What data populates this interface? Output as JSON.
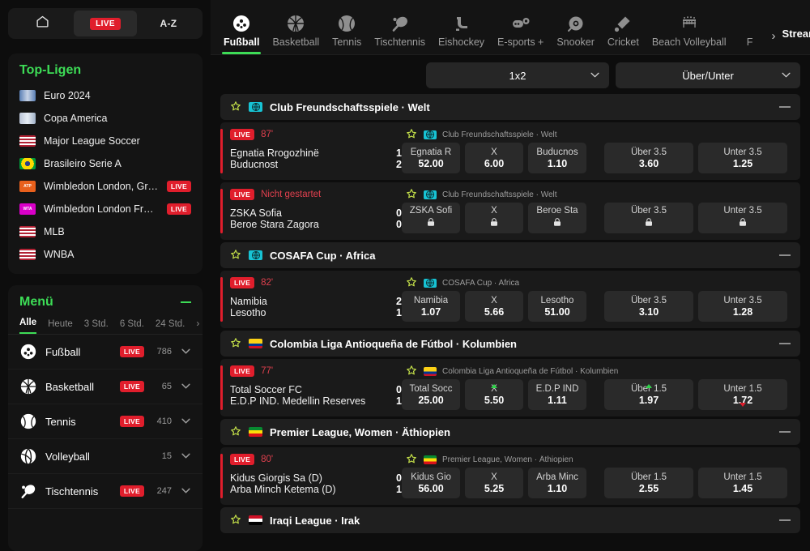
{
  "sidebar": {
    "nav": [
      {
        "id": "home",
        "icon": "home-icon",
        "label": "",
        "active": false
      },
      {
        "id": "live",
        "icon": "live-badge",
        "label": "LIVE",
        "active": true
      },
      {
        "id": "az",
        "icon": "az-text",
        "label": "A-Z",
        "active": false
      }
    ],
    "top_leagues": {
      "title": "Top-Ligen",
      "items": [
        {
          "label": "Euro 2024",
          "flag": "euro",
          "live": ""
        },
        {
          "label": "Copa America",
          "flag": "copa",
          "live": ""
        },
        {
          "label": "Major League Soccer",
          "flag": "us",
          "live": ""
        },
        {
          "label": "Brasileiro Serie A",
          "flag": "br",
          "live": ""
        },
        {
          "label": "Wimbledon London, Gros...",
          "flag": "atp",
          "live": "LIVE"
        },
        {
          "label": "Wimbledon London Fraue...",
          "flag": "wta",
          "live": "LIVE"
        },
        {
          "label": "MLB",
          "flag": "us",
          "live": ""
        },
        {
          "label": "WNBA",
          "flag": "us",
          "live": ""
        }
      ]
    },
    "menu": {
      "title": "Menü",
      "time_filters": [
        {
          "label": "Alle",
          "active": true
        },
        {
          "label": "Heute",
          "active": false
        },
        {
          "label": "3 Std.",
          "active": false
        },
        {
          "label": "6 Std.",
          "active": false
        },
        {
          "label": "24 Std.",
          "active": false
        }
      ],
      "time_filter_more": "›",
      "sports": [
        {
          "label": "Fußball",
          "icon": "football-icon",
          "live": "LIVE",
          "count": "786"
        },
        {
          "label": "Basketball",
          "icon": "basketball-icon",
          "live": "LIVE",
          "count": "65"
        },
        {
          "label": "Tennis",
          "icon": "tennis-icon",
          "live": "LIVE",
          "count": "410"
        },
        {
          "label": "Volleyball",
          "icon": "volleyball-icon",
          "live": "",
          "count": "15"
        },
        {
          "label": "Tischtennis",
          "icon": "tabletennis-icon",
          "live": "LIVE",
          "count": "247"
        }
      ]
    }
  },
  "header": {
    "sports": [
      {
        "label": "Fußball",
        "icon": "football-icon",
        "active": true
      },
      {
        "label": "Basketball",
        "icon": "basketball-icon",
        "active": false
      },
      {
        "label": "Tennis",
        "icon": "tennis-icon",
        "active": false
      },
      {
        "label": "Tischtennis",
        "icon": "tabletennis-icon",
        "active": false
      },
      {
        "label": "Eishockey",
        "icon": "icehockey-icon",
        "active": false
      },
      {
        "label": "E-sports +",
        "icon": "esports-icon",
        "active": false
      },
      {
        "label": "Snooker",
        "icon": "snooker-icon",
        "active": false
      },
      {
        "label": "Cricket",
        "icon": "cricket-icon",
        "active": false
      },
      {
        "label": "Beach Volleyball",
        "icon": "beachvolley-icon",
        "active": false
      },
      {
        "label": "F",
        "icon": "more-icon",
        "active": false
      }
    ],
    "more_arrow": "›",
    "streaming_label": "Streaming",
    "streaming_on": false
  },
  "markets": {
    "market1": "1x2",
    "market2": "Über/Unter"
  },
  "sections": [
    {
      "league": "Club Freundschaftsspiele · Welt",
      "flag": "world",
      "matches": [
        {
          "status": "LIVE",
          "time": "87'",
          "league": "Club Freundschaftsspiele · Welt",
          "flag": "world",
          "home": "Egnatia Rrogozhinë",
          "away": "Buducnost",
          "home_score": "1",
          "away_score": "2",
          "odds": [
            {
              "label": "Egnatia R",
              "value": "52.00",
              "locked": false,
              "trend": ""
            },
            {
              "label": "X",
              "value": "6.00",
              "locked": false,
              "trend": ""
            },
            {
              "label": "Buducnos",
              "value": "1.10",
              "locked": false,
              "trend": ""
            }
          ],
          "ou": [
            {
              "label": "Über 3.5",
              "value": "3.60",
              "locked": false,
              "trend": ""
            },
            {
              "label": "Unter 3.5",
              "value": "1.25",
              "locked": false,
              "trend": ""
            }
          ]
        },
        {
          "status": "LIVE",
          "time": "Nicht gestartet",
          "league": "Club Freundschaftsspiele · Welt",
          "flag": "world",
          "home": "ZSKA Sofia",
          "away": "Beroe Stara Zagora",
          "home_score": "0",
          "away_score": "0",
          "odds": [
            {
              "label": "ZSKA Sofi",
              "value": "",
              "locked": true,
              "trend": ""
            },
            {
              "label": "X",
              "value": "",
              "locked": true,
              "trend": ""
            },
            {
              "label": "Beroe Sta",
              "value": "",
              "locked": true,
              "trend": ""
            }
          ],
          "ou": [
            {
              "label": "Über 3.5",
              "value": "",
              "locked": true,
              "trend": ""
            },
            {
              "label": "Unter 3.5",
              "value": "",
              "locked": true,
              "trend": ""
            }
          ]
        }
      ]
    },
    {
      "league": "COSAFA Cup · Africa",
      "flag": "world",
      "matches": [
        {
          "status": "LIVE",
          "time": "82'",
          "league": "COSAFA Cup · Africa",
          "flag": "world",
          "home": "Namibia",
          "away": "Lesotho",
          "home_score": "2",
          "away_score": "1",
          "odds": [
            {
              "label": "Namibia",
              "value": "1.07",
              "locked": false,
              "trend": ""
            },
            {
              "label": "X",
              "value": "5.66",
              "locked": false,
              "trend": ""
            },
            {
              "label": "Lesotho",
              "value": "51.00",
              "locked": false,
              "trend": ""
            }
          ],
          "ou": [
            {
              "label": "Über 3.5",
              "value": "3.10",
              "locked": false,
              "trend": ""
            },
            {
              "label": "Unter 3.5",
              "value": "1.28",
              "locked": false,
              "trend": ""
            }
          ]
        }
      ]
    },
    {
      "league": "Colombia Liga Antioqueña de Fútbol · Kolumbien",
      "flag": "co",
      "matches": [
        {
          "status": "LIVE",
          "time": "77'",
          "league": "Colombia Liga Antioqueña de Fútbol · Kolumbien",
          "flag": "co",
          "home": "Total Soccer FC",
          "away": "E.D.P IND. Medellin Reserves",
          "home_score": "0",
          "away_score": "1",
          "odds": [
            {
              "label": "Total Socc",
              "value": "25.00",
              "locked": false,
              "trend": ""
            },
            {
              "label": "X",
              "value": "5.50",
              "locked": false,
              "trend": "up"
            },
            {
              "label": "E.D.P IND",
              "value": "1.11",
              "locked": false,
              "trend": ""
            }
          ],
          "ou": [
            {
              "label": "Über 1.5",
              "value": "1.97",
              "locked": false,
              "trend": "up"
            },
            {
              "label": "Unter 1.5",
              "value": "1.72",
              "locked": false,
              "trend": "down"
            }
          ]
        }
      ]
    },
    {
      "league": "Premier League, Women · Äthiopien",
      "flag": "et",
      "matches": [
        {
          "status": "LIVE",
          "time": "80'",
          "league": "Premier League, Women · Äthiopien",
          "flag": "et",
          "home": "Kidus Giorgis Sa (D)",
          "away": "Arba Minch Ketema (D)",
          "home_score": "0",
          "away_score": "1",
          "odds": [
            {
              "label": "Kidus Gio",
              "value": "56.00",
              "locked": false,
              "trend": ""
            },
            {
              "label": "X",
              "value": "5.25",
              "locked": false,
              "trend": ""
            },
            {
              "label": "Arba Minc",
              "value": "1.10",
              "locked": false,
              "trend": ""
            }
          ],
          "ou": [
            {
              "label": "Über 1.5",
              "value": "2.55",
              "locked": false,
              "trend": ""
            },
            {
              "label": "Unter 1.5",
              "value": "1.45",
              "locked": false,
              "trend": ""
            }
          ]
        }
      ]
    },
    {
      "league": "Iraqi League · Irak",
      "flag": "iq",
      "matches": []
    }
  ],
  "colors": {
    "accent_green": "#3ddc56",
    "live_red": "#e01e2c",
    "bg": "#0d0d0d",
    "panel": "#141414",
    "row": "#1a1a1a",
    "odd_cell": "#2a2a2a",
    "star_yellow": "#c6e24a",
    "trend_up": "#2fd34a",
    "trend_down": "#e01e2c"
  },
  "icons": {
    "lock": "🔒",
    "star": "☆",
    "chevron_down": "⌄"
  }
}
